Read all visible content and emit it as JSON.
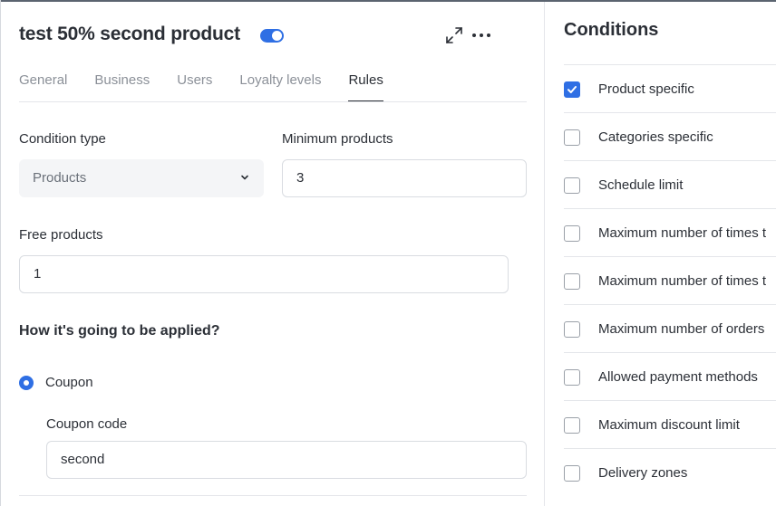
{
  "header": {
    "title": "test 50% second product",
    "enabled": true
  },
  "tabs": [
    {
      "label": "General",
      "active": false
    },
    {
      "label": "Business",
      "active": false
    },
    {
      "label": "Users",
      "active": false
    },
    {
      "label": "Loyalty levels",
      "active": false
    },
    {
      "label": "Rules",
      "active": true
    }
  ],
  "form": {
    "condition_type_label": "Condition type",
    "condition_type_value": "Products",
    "minimum_products_label": "Minimum products",
    "minimum_products_value": "3",
    "free_products_label": "Free products",
    "free_products_value": "1",
    "applied_title": "How it's going to be applied?",
    "coupon_option_label": "Coupon",
    "coupon_selected": true,
    "coupon_code_label": "Coupon code",
    "coupon_code_value": "second"
  },
  "conditions": {
    "title": "Conditions",
    "items": [
      {
        "label": "Product specific",
        "checked": true
      },
      {
        "label": "Categories specific",
        "checked": false
      },
      {
        "label": "Schedule limit",
        "checked": false
      },
      {
        "label": "Maximum number of times t",
        "checked": false
      },
      {
        "label": "Maximum number of times t",
        "checked": false
      },
      {
        "label": "Maximum number of orders",
        "checked": false
      },
      {
        "label": "Allowed payment methods",
        "checked": false
      },
      {
        "label": "Maximum discount limit",
        "checked": false
      },
      {
        "label": "Delivery zones",
        "checked": false
      }
    ]
  },
  "icons": {
    "expand": "expand-icon",
    "more": "more-horizontal-icon",
    "chevron": "chevron-down-icon",
    "check": "check-icon"
  },
  "colors": {
    "accent": "#2f6fe4",
    "text": "#2b2f36",
    "muted": "#8b9098"
  }
}
